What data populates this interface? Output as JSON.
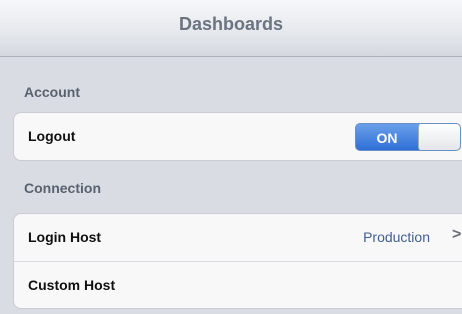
{
  "navbar": {
    "title": "Dashboards"
  },
  "sections": {
    "account": {
      "header": "Account",
      "logout": {
        "label": "Logout",
        "toggle_state": "ON"
      }
    },
    "connection": {
      "header": "Connection",
      "login_host": {
        "label": "Login Host",
        "value": "Production",
        "chevron": ">"
      },
      "custom_host": {
        "label": "Custom Host"
      }
    }
  },
  "colors": {
    "toggle_on": "#2f6fd6",
    "value_text": "#3f5f93"
  }
}
